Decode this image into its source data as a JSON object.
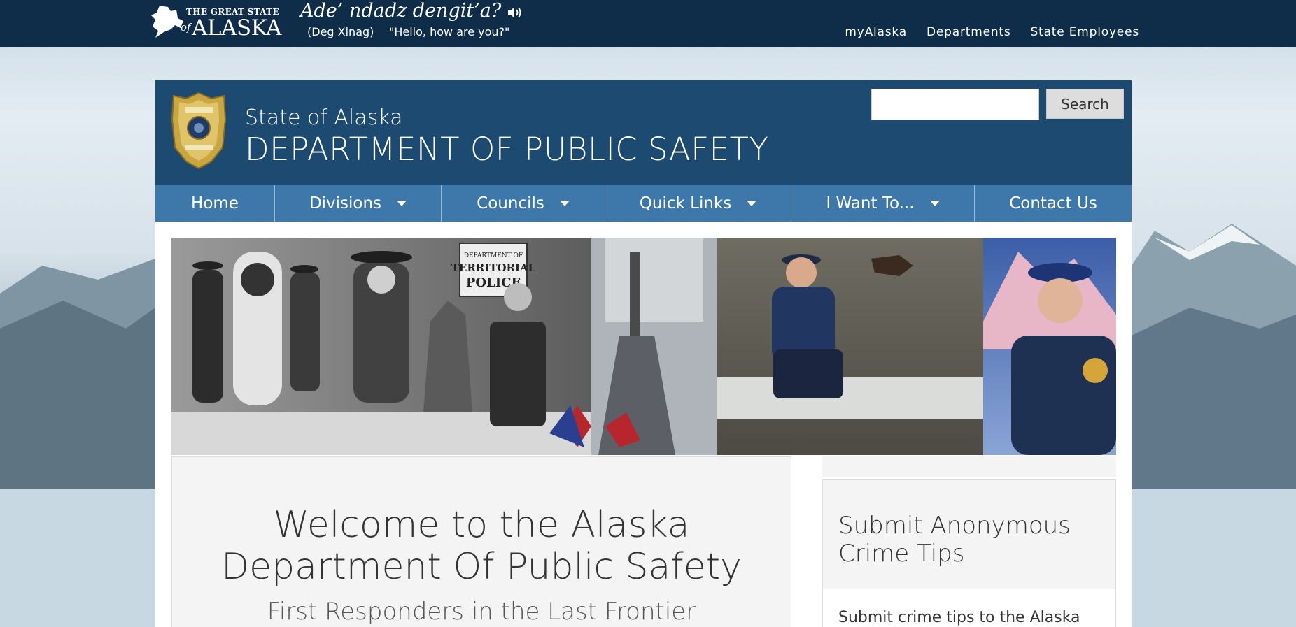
{
  "topbar": {
    "logo_small": "THE GREAT STATE",
    "logo_of": "of",
    "logo_big": "ALASKA",
    "greeting": "Ade’ ndadz dengit’a?",
    "language": "(Deg Xinag)",
    "translation": "\"Hello, how are you?\"",
    "links": [
      "myAlaska",
      "Departments",
      "State Employees"
    ]
  },
  "header": {
    "state_line": "State of Alaska",
    "dept_line": "DEPARTMENT OF PUBLIC SAFETY",
    "search_placeholder": "",
    "search_button": "Search"
  },
  "nav": {
    "items": [
      {
        "label": "Home",
        "dropdown": false
      },
      {
        "label": "Divisions",
        "dropdown": true
      },
      {
        "label": "Councils",
        "dropdown": true
      },
      {
        "label": "Quick Links",
        "dropdown": true
      },
      {
        "label": "I Want To...",
        "dropdown": true
      },
      {
        "label": "Contact Us",
        "dropdown": false
      }
    ]
  },
  "banner": {
    "sign_line1": "DEPARTMENT OF",
    "sign_line2": "TERRITORIAL",
    "sign_line3": "POLICE"
  },
  "welcome": {
    "title_line1": "Welcome to the Alaska",
    "title_line2": "Department Of Public Safety",
    "subtitle": "First Responders in the Last Frontier"
  },
  "sidebar": {
    "tips_title_line1": "Submit Anonymous",
    "tips_title_line2": "Crime Tips",
    "tips_body": "Submit crime tips to the Alaska"
  },
  "colors": {
    "topbar": "#0f2d49",
    "header": "#1c4a70",
    "nav": "#3e77aa",
    "panel": "#f4f4f4"
  }
}
